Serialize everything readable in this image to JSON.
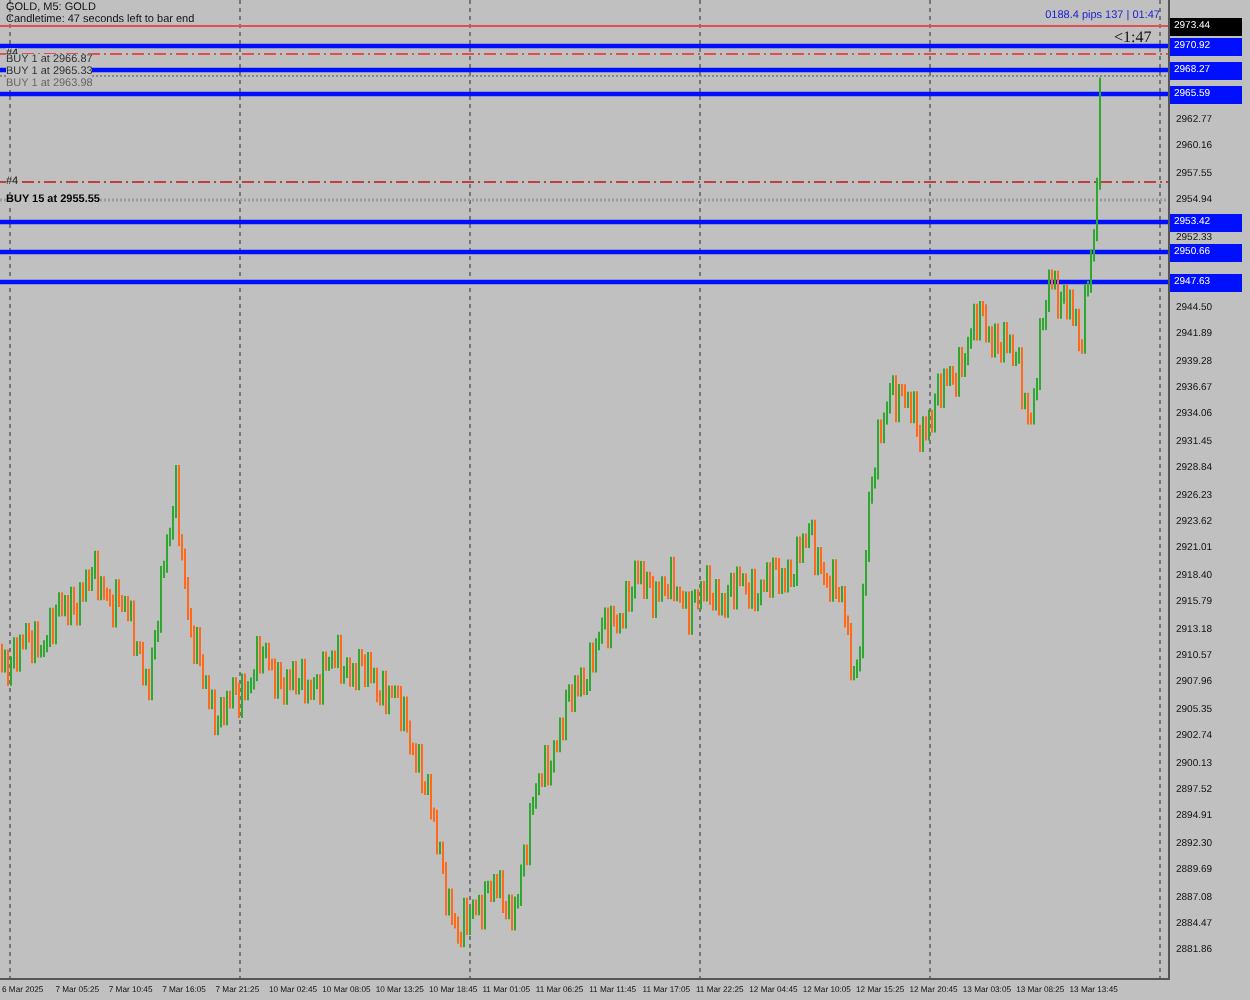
{
  "header": {
    "symbol": "GOLD, M5: GOLD",
    "countdown": "Candletime: 47 seconds left to bar end"
  },
  "order_labels": [
    {
      "text": "BUY 1 at 2966.87",
      "kind": "order"
    },
    {
      "text": "BUY 1 at 2965.33",
      "kind": "order"
    },
    {
      "text": "BUY 1 at 2963.98",
      "kind": "faint"
    },
    {
      "text": "BUY 15 at 2955.55",
      "kind": "bold"
    }
  ],
  "order_marks": [
    "#4",
    "#4"
  ],
  "price_tag": "0188.4 pips 137 | 01:47",
  "timer": "<1:47",
  "line_tags": [
    {
      "text": "2973.44",
      "kind": "bid"
    },
    {
      "text": "2970.92",
      "kind": "level"
    },
    {
      "text": "2968.27",
      "kind": "level"
    },
    {
      "text": "2965.59",
      "kind": "level"
    },
    {
      "text": "2953.42",
      "kind": "level"
    },
    {
      "text": "2950.66",
      "kind": "level"
    },
    {
      "text": "2947.63",
      "kind": "level"
    }
  ],
  "price_axis": [
    "2962.77",
    "2960.16",
    "2957.55",
    "2954.94",
    "2952.33",
    "2944.50",
    "2941.89",
    "2939.28",
    "2936.67",
    "2934.06",
    "2931.45",
    "2928.84",
    "2926.23",
    "2923.62",
    "2921.01",
    "2918.40",
    "2915.79",
    "2913.18",
    "2910.57",
    "2907.96",
    "2905.35",
    "2902.74",
    "2900.13",
    "2897.52",
    "2894.91",
    "2892.30",
    "2889.69",
    "2887.08",
    "2884.47",
    "2881.86"
  ],
  "time_axis": [
    "6 Mar 2025",
    "7 Mar 05:25",
    "7 Mar 10:45",
    "7 Mar 16:05",
    "7 Mar 21:25",
    "10 Mar 02:45",
    "10 Mar 08:05",
    "10 Mar 13:25",
    "10 Mar 18:45",
    "11 Mar 01:05",
    "11 Mar 06:25",
    "11 Mar 11:45",
    "11 Mar 17:05",
    "11 Mar 22:25",
    "12 Mar 04:45",
    "12 Mar 10:05",
    "12 Mar 15:25",
    "12 Mar 20:45",
    "13 Mar 03:05",
    "13 Mar 08:25",
    "13 Mar 13:45"
  ]
}
